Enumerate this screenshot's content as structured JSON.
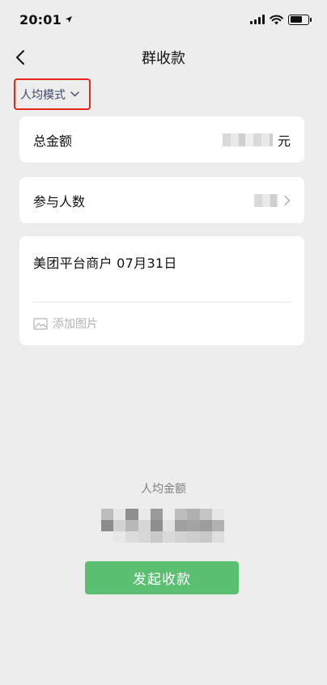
{
  "status_bar": {
    "time": "20:01",
    "location_icon": "location-arrow-icon",
    "signal_icon": "cellular-signal-icon",
    "wifi_icon": "wifi-icon",
    "battery_icon": "battery-icon"
  },
  "nav": {
    "title": "群收款",
    "back_icon": "chevron-left-icon"
  },
  "mode": {
    "label": "人均模式",
    "chevron_icon": "chevron-down-icon",
    "highlight_color": "#e8271c"
  },
  "total": {
    "label": "总金额",
    "value": "",
    "unit": "元"
  },
  "participants": {
    "label": "参与人数",
    "value": "",
    "chevron_icon": "chevron-right-icon"
  },
  "note": {
    "text": "美团平台商户 07月31日",
    "add_image_label": "添加图片",
    "add_image_icon": "image-icon"
  },
  "average": {
    "label": "人均金额",
    "value": ""
  },
  "submit": {
    "label": "发起收款",
    "color": "#5bbf72"
  }
}
